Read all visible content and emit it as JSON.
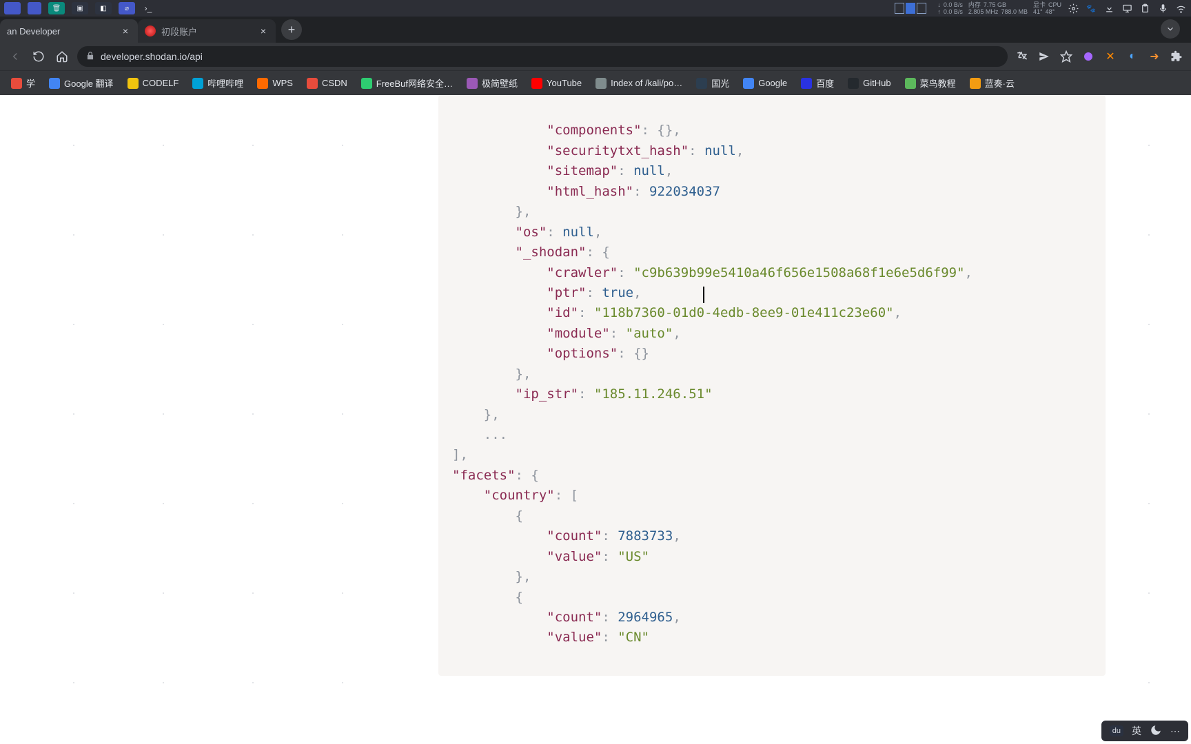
{
  "menubar": {
    "stats": {
      "net_down": "0.0 B/s",
      "net_up": "0.0 B/s",
      "mem_label": "内存",
      "mem_value": "7.75 GB",
      "mem_rate": "2.805 MHz",
      "swap_value": "788.0 MB",
      "cpu_label": "CPU",
      "gpu_label": "显卡",
      "temp1": "41°",
      "temp2": "48°"
    }
  },
  "tabs": [
    {
      "title": "an Developer",
      "active": true
    },
    {
      "title": "初段账户",
      "active": false
    }
  ],
  "address": {
    "url": "developer.shodan.io/api"
  },
  "bookmarks": [
    {
      "label": "学",
      "color": "#e74c3c"
    },
    {
      "label": "Google 翻译",
      "color": "#4285f4"
    },
    {
      "label": "CODELF",
      "color": "#f1c40f"
    },
    {
      "label": "哔哩哔哩",
      "color": "#00a1d6"
    },
    {
      "label": "WPS",
      "color": "#ff6a00"
    },
    {
      "label": "CSDN",
      "color": "#e74c3c"
    },
    {
      "label": "FreeBuf网络安全…",
      "color": "#2ecc71"
    },
    {
      "label": "极简壁纸",
      "color": "#9b59b6"
    },
    {
      "label": "YouTube",
      "color": "#ff0000"
    },
    {
      "label": "Index of /kali/po…",
      "color": "#7f8c8d"
    },
    {
      "label": "国光",
      "color": "#2c3e50"
    },
    {
      "label": "Google",
      "color": "#4285f4"
    },
    {
      "label": "百度",
      "color": "#2932e1"
    },
    {
      "label": "GitHub",
      "color": "#24292e"
    },
    {
      "label": "菜鸟教程",
      "color": "#5cb85c"
    },
    {
      "label": "蓝奏·云",
      "color": "#f39c12"
    }
  ],
  "ime": {
    "lang": "英"
  },
  "code": {
    "l1": "            \"components\": {},",
    "l2a": "            \"securitytxt_hash\": ",
    "l2b": "null",
    "l2c": ",",
    "l3a": "            \"sitemap\": ",
    "l3b": "null",
    "l3c": ",",
    "l4a": "            \"html_hash\": ",
    "l4b": "922034037",
    "l5": "        },",
    "l6a": "        \"os\": ",
    "l6b": "null",
    "l6c": ",",
    "l7": "        \"_shodan\": {",
    "l8a": "            \"crawler\": ",
    "l8b": "\"c9b639b99e5410a46f656e1508a68f1e6e5d6f99\"",
    "l8c": ",",
    "l9a": "            \"ptr\": ",
    "l9b": "true",
    "l9c": ",",
    "l10a": "            \"id\": ",
    "l10b": "\"118b7360-01d0-4edb-8ee9-01e411c23e60\"",
    "l10c": ",",
    "l11a": "            \"module\": ",
    "l11b": "\"auto\"",
    "l11c": ",",
    "l12": "            \"options\": {}",
    "l13": "        },",
    "l14a": "        \"ip_str\": ",
    "l14b": "\"185.11.246.51\"",
    "l15": "    },",
    "l16": "    ...",
    "l17": "],",
    "l18": "\"facets\": {",
    "l19": "    \"country\": [",
    "l20": "        {",
    "l21a": "            \"count\": ",
    "l21b": "7883733",
    "l21c": ",",
    "l22a": "            \"value\": ",
    "l22b": "\"US\"",
    "l23": "        },",
    "l24": "        {",
    "l25a": "            \"count\": ",
    "l25b": "2964965",
    "l25c": ",",
    "l26a": "            \"value\": ",
    "l26b": "\"CN\""
  }
}
